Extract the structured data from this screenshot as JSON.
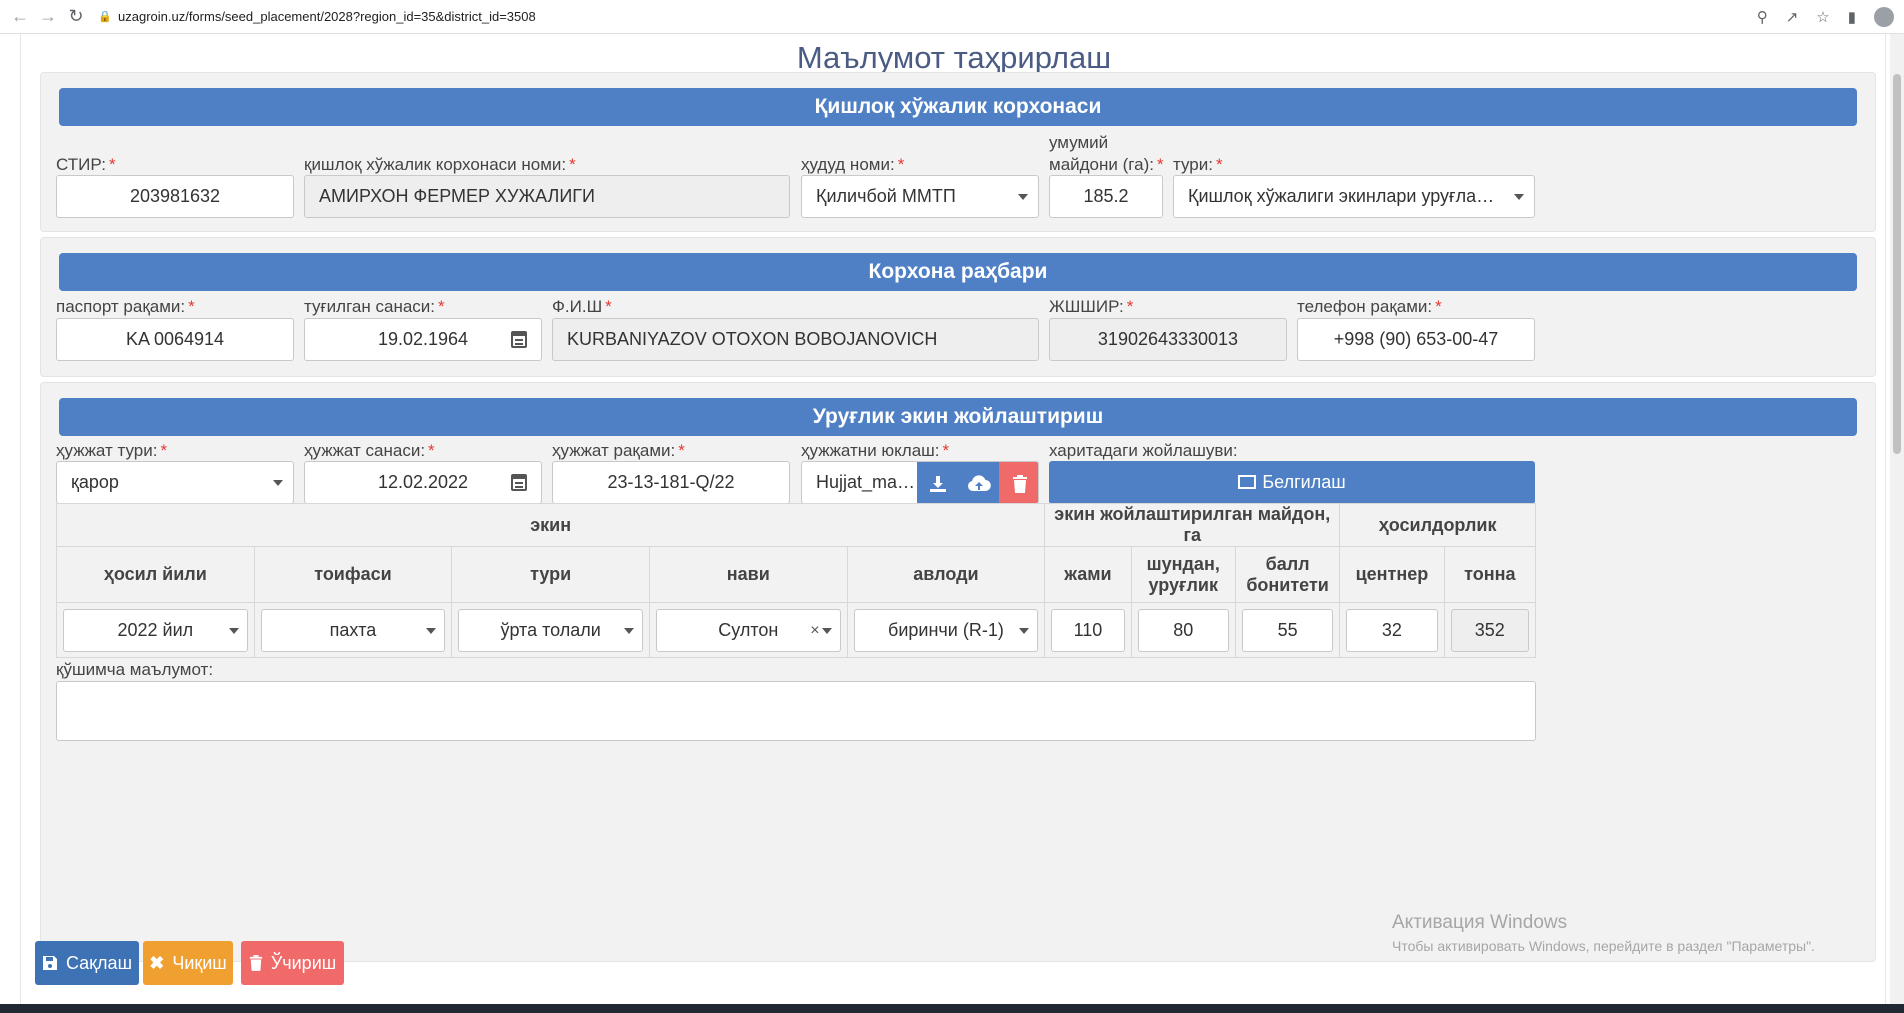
{
  "browser": {
    "url": "uzagroin.uz/forms/seed_placement/2028?region_id=35&district_id=3508"
  },
  "page_title": "Маълумот таҳрирлаш",
  "section1": {
    "header": "Қишлоқ хўжалик корхонаси",
    "stir_label": "СТИР:",
    "stir_value": "203981632",
    "name_label": "қишлоқ хўжалик корхонаси номи:",
    "name_value": "АМИРХОН ФЕРМЕР ХУЖАЛИГИ",
    "territory_label": "ҳудуд номи:",
    "territory_value": "Қиличбой ММТП",
    "area_label_1": "умумий",
    "area_label_2": "майдони (га):",
    "area_value": "185.2",
    "type_label": "тури:",
    "type_value": "Қишлоқ хўжалиги экинлари уруғларини ети..."
  },
  "section2": {
    "header": "Корхона раҳбари",
    "passport_label": "паспорт рақами:",
    "passport_value": "KA 0064914",
    "birth_label": "туғилган санаси:",
    "birth_value": "19.02.1964",
    "fio_label": "Ф.И.Ш",
    "fio_value": "KURBANIYAZOV OTOXON BOBOJANOVICH",
    "jshshir_label": "ЖШШИР:",
    "jshshir_value": "31902643330013",
    "phone_label": "телефон рақами:",
    "phone_value": "+998 (90) 653-00-47"
  },
  "section3": {
    "header": "Уруғлик экин жойлаштириш",
    "doc_type_label": "ҳужжат тури:",
    "doc_type_value": "қарор",
    "doc_date_label": "ҳужжат санаси:",
    "doc_date_value": "12.02.2022",
    "doc_number_label": "ҳужжат рақами:",
    "doc_number_value": "23-13-181-Q/22",
    "upload_label": "ҳужжатни юклаш:",
    "upload_value": "Hujjat_mat...",
    "map_label": "харитадаги жойлашуви:",
    "map_button": "Белгилаш",
    "table": {
      "group_crop": "экин",
      "group_area": "экин жойлаштирилган майдон, га",
      "group_yield": "ҳосилдорлик",
      "col_year": "ҳосил йили",
      "col_category": "тоифаси",
      "col_type": "тури",
      "col_variety": "нави",
      "col_generation": "авлоди",
      "col_total": "жами",
      "col_seed_1": "шундан,",
      "col_seed_2": "уруғлик",
      "col_bonitet_1": "балл",
      "col_bonitet_2": "бонитети",
      "col_centner": "центнер",
      "col_ton": "тонна",
      "row": {
        "year": "2022 йил",
        "category": "пахта",
        "type": "ўрта толали",
        "variety": "Султон",
        "generation": "биринчи (R-1)",
        "total": "110",
        "seed": "80",
        "bonitet": "55",
        "centner": "32",
        "ton": "352"
      }
    },
    "extra_label": "қўшимча маълумот:"
  },
  "buttons": {
    "save": "Сақлаш",
    "exit": "Чиқиш",
    "delete": "Ўчириш"
  },
  "watermark": {
    "title": "Активация Windows",
    "text": "Чтобы активировать Windows, перейдите в раздел \"Параметры\"."
  },
  "colors": {
    "header_blue": "#4f80c6",
    "save": "#3d72b4",
    "exit": "#f0a030",
    "delete": "#f06a6a",
    "required": "#e53935"
  }
}
